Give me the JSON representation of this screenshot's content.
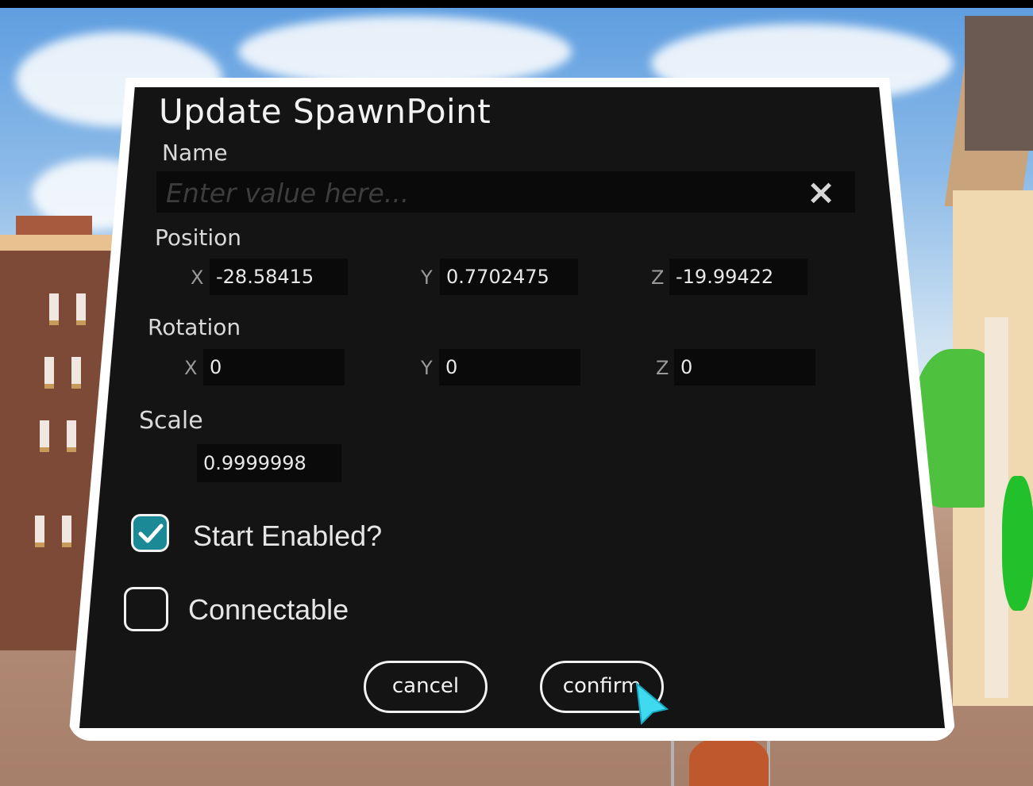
{
  "dialog": {
    "title": "Update SpawnPoint",
    "name_label": "Name",
    "name_placeholder": "Enter value here...",
    "name_value": "",
    "clear_icon": "×"
  },
  "position": {
    "label": "Position",
    "x": {
      "axis": "X",
      "value": "-28.58415"
    },
    "y": {
      "axis": "Y",
      "value": "0.7702475"
    },
    "z": {
      "axis": "Z",
      "value": "-19.99422"
    }
  },
  "rotation": {
    "label": "Rotation",
    "x": {
      "axis": "X",
      "value": "0"
    },
    "y": {
      "axis": "Y",
      "value": "0"
    },
    "z": {
      "axis": "Z",
      "value": "0"
    }
  },
  "scale": {
    "label": "Scale",
    "value": "0.9999998"
  },
  "options": {
    "start_enabled": {
      "label": "Start Enabled?",
      "checked": true
    },
    "connectable": {
      "label": "Connectable",
      "checked": false
    }
  },
  "buttons": {
    "cancel": "cancel",
    "confirm": "confirm"
  },
  "colors": {
    "panel_bg": "#141414",
    "panel_border": "#ffffff",
    "checkbox_accent": "#1b8a96",
    "pointer": "#3fd9f0"
  },
  "icons": {
    "clear": "close-icon",
    "check": "checkmark-icon",
    "pointer": "vr-pointer-icon"
  }
}
